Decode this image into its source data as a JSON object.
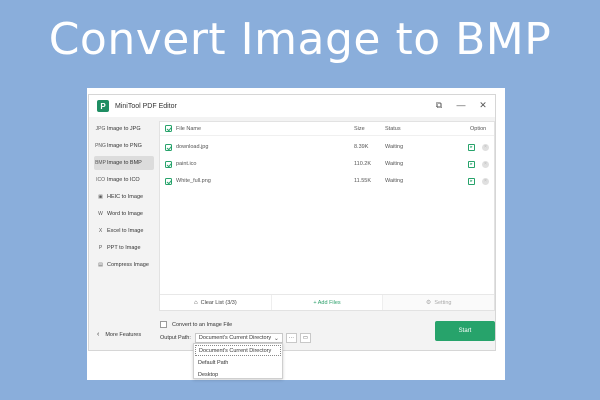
{
  "hero": {
    "title": "Convert Image to BMP"
  },
  "window": {
    "app_logo": "P",
    "title": "MiniTool PDF Editor",
    "controls": {
      "pin": "⧉",
      "minimize": "—",
      "close": "✕"
    }
  },
  "sidebar": {
    "items": [
      {
        "label": "Image to JPG",
        "icon": "JPG",
        "active": false
      },
      {
        "label": "Image to PNG",
        "icon": "PNG",
        "active": false
      },
      {
        "label": "Image to BMP",
        "icon": "BMP",
        "active": true
      },
      {
        "label": "Image to ICO",
        "icon": "ICO",
        "active": false
      },
      {
        "label": "HEIC to Image",
        "icon": "▣",
        "active": false
      },
      {
        "label": "Word to Image",
        "icon": "W",
        "active": false
      },
      {
        "label": "Excel to Image",
        "icon": "X",
        "active": false
      },
      {
        "label": "PPT to Image",
        "icon": "P",
        "active": false
      },
      {
        "label": "Compress Image",
        "icon": "▤",
        "active": false
      }
    ],
    "more_features": "More Features"
  },
  "table": {
    "headers": {
      "name": "File Name",
      "size": "Size",
      "status": "Status",
      "option": "Option"
    },
    "rows": [
      {
        "name": "download.jpg",
        "size": "8.39K",
        "status": "Waiting"
      },
      {
        "name": "paint.ico",
        "size": "110.2K",
        "status": "Waiting"
      },
      {
        "name": "White_full.png",
        "size": "11.55K",
        "status": "Waiting"
      }
    ]
  },
  "toolbar": {
    "clear_label": "Clear List (3/3)",
    "add_label": "+ Add Files",
    "setting_label": "Setting"
  },
  "options": {
    "convert_label": "Convert to an Image File",
    "output_label": "Output Path:",
    "output_value": "Document's Current Directory",
    "more_btn": "···",
    "start_label": "Start"
  },
  "dropdown": {
    "options": [
      "Document's Current Directory",
      "Default Path",
      "Desktop"
    ]
  },
  "colors": {
    "accent": "#27a36b",
    "background": "#8aaedb"
  }
}
